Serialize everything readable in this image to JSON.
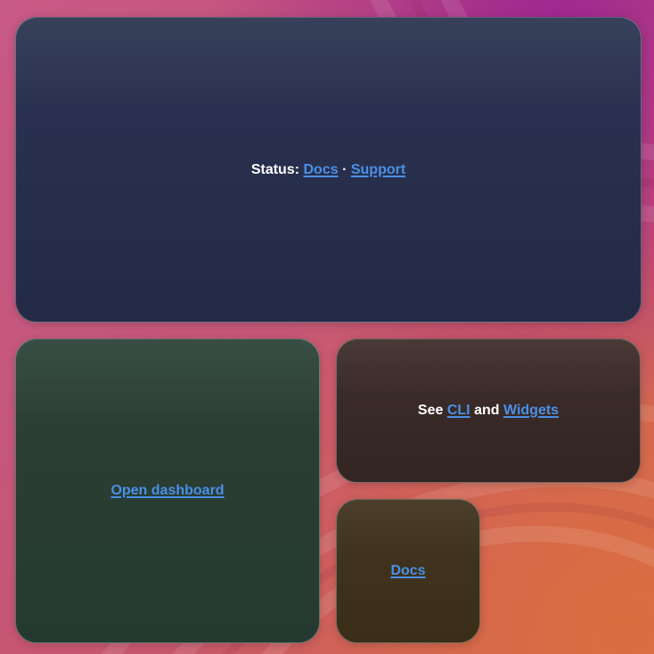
{
  "status_card": {
    "prefix": "Status:",
    "link_docs": "Docs",
    "separator": "·",
    "link_support": "Support"
  },
  "dashboard_card": {
    "link": "Open dashboard"
  },
  "see_card": {
    "prefix": "See",
    "link_cli": "CLI",
    "middle": "and",
    "link_widgets": "Widgets"
  },
  "docs_card": {
    "link": "Docs"
  },
  "colors": {
    "link": "#4a90e8",
    "status_card_bg": "#262d48",
    "dashboard_card_bg": "#293d33",
    "see_card_bg": "#382a27",
    "docs_card_bg": "#3e321d"
  }
}
